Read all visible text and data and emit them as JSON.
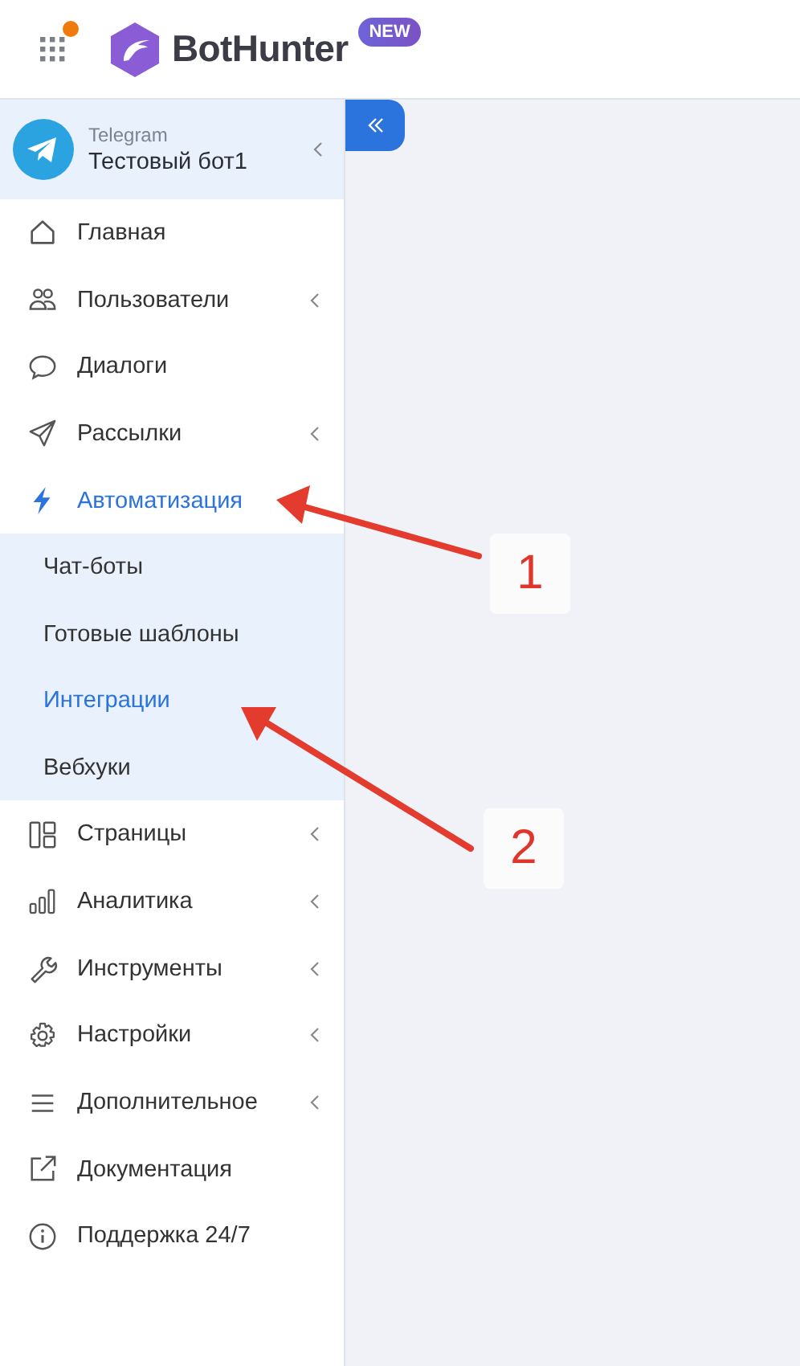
{
  "header": {
    "logo_text": "BotHunter",
    "badge": "NEW",
    "apps_notification": true
  },
  "bot": {
    "platform": "Telegram",
    "name": "Тестовый бот1"
  },
  "menu": [
    {
      "label": "Главная",
      "selected": false,
      "chevron": false
    },
    {
      "label": "Пользователи",
      "selected": false,
      "chevron": true
    },
    {
      "label": "Диалоги",
      "selected": false,
      "chevron": false
    },
    {
      "label": "Рассылки",
      "selected": false,
      "chevron": true
    },
    {
      "label": "Автоматизация",
      "selected": true,
      "chevron": false,
      "children": [
        {
          "label": "Чат-боты",
          "selected": false
        },
        {
          "label": "Готовые шаблоны",
          "selected": false
        },
        {
          "label": "Интеграции",
          "selected": true
        },
        {
          "label": "Вебхуки",
          "selected": false
        }
      ]
    },
    {
      "label": "Страницы",
      "selected": false,
      "chevron": true
    },
    {
      "label": "Аналитика",
      "selected": false,
      "chevron": true
    },
    {
      "label": "Инструменты",
      "selected": false,
      "chevron": true
    },
    {
      "label": "Настройки",
      "selected": false,
      "chevron": true
    },
    {
      "label": "Дополнительное",
      "selected": false,
      "chevron": true
    },
    {
      "label": "Документация",
      "selected": false,
      "chevron": false
    },
    {
      "label": "Поддержка 24/7",
      "selected": false,
      "chevron": false
    }
  ],
  "annotations": [
    {
      "label": "1"
    },
    {
      "label": "2"
    }
  ]
}
